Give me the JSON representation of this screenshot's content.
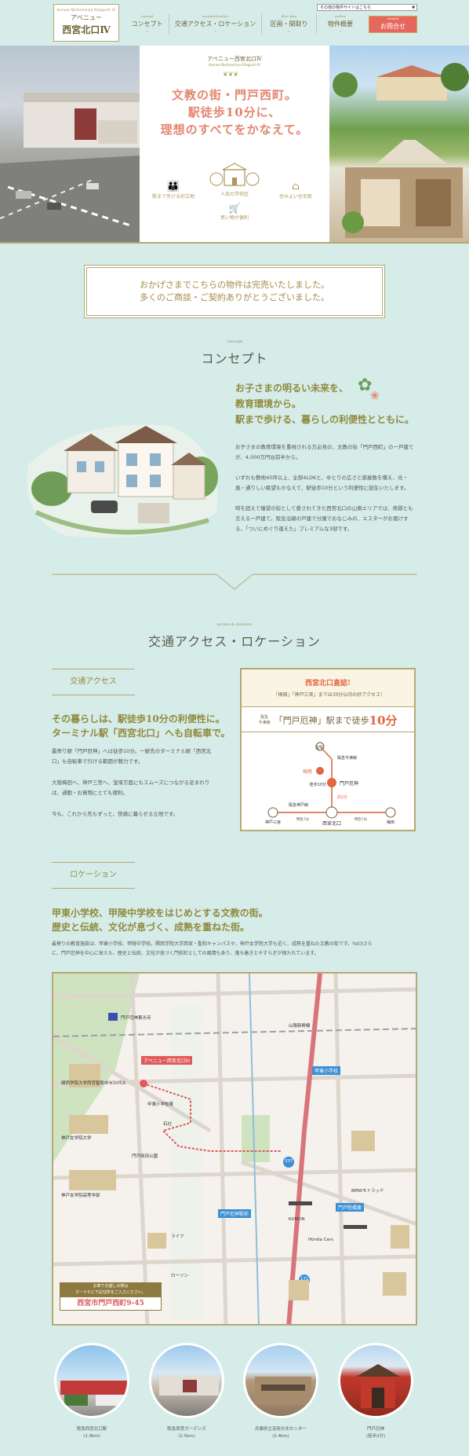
{
  "header": {
    "logo_small": "Avenue Nishinomiya Kitaguchi IV",
    "logo_name": "アベニュー",
    "logo_main": "西宮北口Ⅳ",
    "site_select": "その他の物件サイトはこちら",
    "nav": [
      {
        "en": "concept",
        "label": "コンセプト"
      },
      {
        "en": "access&location",
        "label": "交通アクセス・ロケーション"
      },
      {
        "en": "floor plan",
        "label": "区画・間取り"
      },
      {
        "en": "outline",
        "label": "物件概要"
      }
    ],
    "contact_en": "contact",
    "contact_label": "お問合せ"
  },
  "hero": {
    "brand": "アベニュー西宮北口Ⅳ",
    "brand_en": "Avenue Nishinomiya Kitaguchi IV",
    "headline": [
      "文教の街・門戸西町。",
      "駅徒歩10分に、",
      "理想のすべてをかなえて。"
    ],
    "features": [
      "駅まで歩ける好立地",
      "人気の学校区",
      "住みよい住宅街",
      "買い物が便利"
    ]
  },
  "notice": {
    "line1": "おかげさまでこちらの物件は完売いたしました。",
    "line2": "多くのご商談・ご契約ありがとうございました。"
  },
  "concept": {
    "en": "concept",
    "title": "コンセプト",
    "lead": [
      "お子さまの明るい未来を、",
      "教育環境から。",
      "駅まで歩ける、暮らしの利便性とともに。"
    ],
    "p1": [
      "お子さまの教育環境を重視される方必見の、文教の街「門戸西町」の一戸建て",
      "が、4,000万円台前半から。"
    ],
    "p2": [
      "いずれも敷地40坪以上、全部4LDKと、ゆとりの広さと部屋数を備え、光・",
      "風・通りしい眺望もかなえて、駅徒歩10分という利便性に誕生いたします。"
    ],
    "p3": [
      "時を超えて憧望の街として愛されてきた西宮北口の山側エリアでは、奇跡とも",
      "言える一戸建て。阪急沿線の戸建で分譲でおなじみの、エスターがお届けす",
      "る、「ついにめぐり逢えた」プレミアムな3邸です。"
    ]
  },
  "access": {
    "en": "access & location",
    "title": "交通アクセス・ロケーション",
    "sub": "交通アクセス",
    "lead": [
      "その暮らしは、駅徒歩10分の利便性に。",
      "ターミナル駅「西宮北口」へも自転車で。"
    ],
    "p1": [
      "最寄り駅「門戸厄神」へは徒歩10分。一駅先のターミナル駅「西宮北",
      "口」も自転車で行ける範囲が魅力です。"
    ],
    "p2": [
      "大阪梅田へ、神戸三宮へ、宝塚方面にもスムーズにつながる足まわり",
      "は、通勤・お買物にとても便利。"
    ],
    "p3": "今も、これから先もずっと、快適に暮らせる立地です。",
    "box_title": "西宮北口直結!",
    "box_sub": "「梅田」「神戸三宮」までは30分以内の好アクセス!",
    "box_prefix_1": "阪急",
    "box_prefix_2": "今津線",
    "box_station": "「門戸厄神」",
    "box_walk": "駅まで徒歩",
    "box_min": "10分",
    "route": {
      "takarazuka": "宝塚",
      "imazu_line": "阪急今津線",
      "site": "現地",
      "walk": "徒歩10分",
      "mondo": "門戸厄神",
      "about2": "約2分",
      "kobe_line": "阪急神戸線",
      "kobe": "神戸三宮",
      "nishikita": "西宮北口",
      "umeda": "梅田",
      "approx15a": "特急7分",
      "approx15b": "特急7分"
    }
  },
  "location": {
    "sub": "ロケーション",
    "lead": [
      "甲東小学校、甲陵中学校をはじめとする文教の街。",
      "歴史と伝統、文化が息づく、成熟を重ねた街。"
    ],
    "p": [
      "最寄りの教育施設は、甲東小学校、甲陵中学校。関西学院大学西宮・聖和キャンパスや、神戸女学院大学も近く、成熟を重ねた文教の街です。%03さら",
      "に、門戸厄神を中心に栄えた、歴史と伝統、文化が息づく門前町としての風情もあり、落ち着きとやすらぎが保たれています。"
    ],
    "map_labels": {
      "site": "アベニュー西宮北口Ⅳ",
      "school": "甲東小学校東",
      "mondo_sta": "門戸厄神駅前",
      "mondo_kado": "門戸陸橋東",
      "koto_school": "甲東小学校",
      "mondo_temple": "門戸厄神東光寺",
      "seiwa": "関西学院大学西宮聖和キャンパス",
      "kobejo": "神戸女学院大学",
      "kobejo_hs": "神戸女学院高等学部",
      "park": "門戸岡田公園",
      "kumon": "KUMON",
      "honda": "Honda Cars",
      "lawson": "ローソン",
      "life": "ライフ",
      "bmw": "BMWモトラッド",
      "ishikawa": "石社",
      "nishinomiya_kita": "西宮北口",
      "sanyo": "山陽新幹線",
      "n171": "171",
      "n337": "337"
    },
    "map_notice": [
      "お車でお越しの際は",
      "カーナビに下記住所をご入力ください。"
    ],
    "address": "西宮市門戸西町9-45"
  },
  "photos": [
    {
      "name": "阪急西宮北口駅",
      "dist": "(1.9km)"
    },
    {
      "name": "阪急西宮ガーデンズ",
      "dist": "(2.5km)"
    },
    {
      "name": "兵庫県立芸術文化センター",
      "dist": "(2.4km)"
    },
    {
      "name": "門戸厄神",
      "dist": "(徒歩2分)"
    }
  ],
  "colors": {
    "background": "#d6ece9",
    "gold": "#b6a875",
    "accent_red": "#e6685d",
    "lead_olive": "#8f8a3c"
  }
}
